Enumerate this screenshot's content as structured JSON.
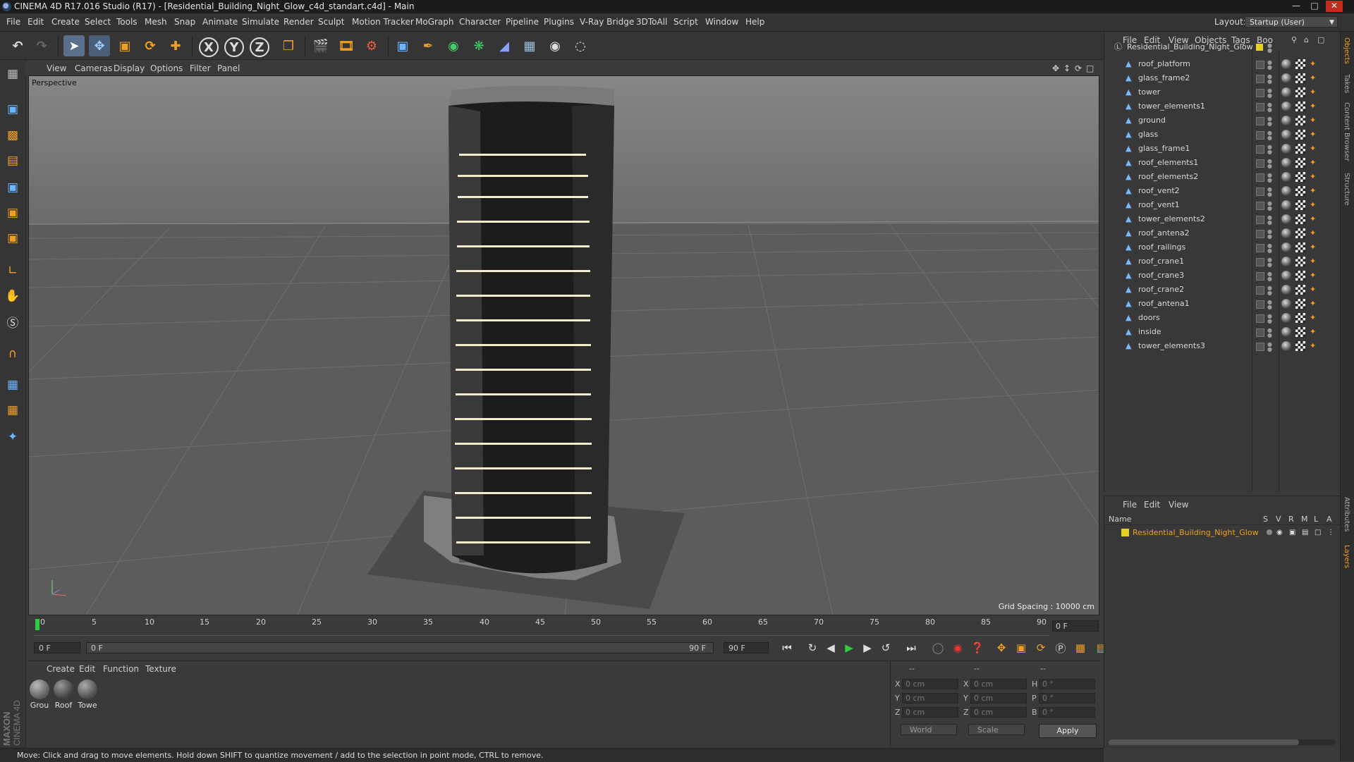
{
  "window": {
    "title": "CINEMA 4D R17.016 Studio (R17) - [Residential_Building_Night_Glow_c4d_standart.c4d] - Main"
  },
  "menu": [
    "File",
    "Edit",
    "Create",
    "Select",
    "Tools",
    "Mesh",
    "Snap",
    "Animate",
    "Simulate",
    "Render",
    "Sculpt",
    "Motion Tracker",
    "MoGraph",
    "Character",
    "Pipeline",
    "Plugins",
    "V-Ray Bridge",
    "3DToAll",
    "Script",
    "Window",
    "Help"
  ],
  "layout": {
    "label": "Layout:",
    "value": "Startup (User)"
  },
  "toolbar": {
    "x_axis": "X",
    "y_axis": "Y",
    "z_axis": "Z"
  },
  "viewport": {
    "menu": [
      "View",
      "Cameras",
      "Display",
      "Options",
      "Filter",
      "Panel"
    ],
    "label": "Perspective",
    "grid_spacing": "Grid Spacing : 10000 cm"
  },
  "timeline": {
    "ticks": [
      "0",
      "5",
      "10",
      "15",
      "20",
      "25",
      "30",
      "35",
      "40",
      "45",
      "50",
      "55",
      "60",
      "65",
      "70",
      "75",
      "80",
      "85",
      "90"
    ],
    "current_frame_right": "0 F",
    "start_field": "0 F",
    "range_start": "0 F",
    "range_end": "90 F",
    "end_field": "90 F"
  },
  "material_manager": {
    "menu": [
      "Create",
      "Edit",
      "Function",
      "Texture"
    ],
    "materials": [
      {
        "label": "Grou",
        "color": "#7a7a7a"
      },
      {
        "label": "Roof",
        "color": "#5b5b5b"
      },
      {
        "label": "Towe",
        "color": "#6d6d6d"
      }
    ]
  },
  "coordinates": {
    "header": [
      "--",
      "--",
      "--"
    ],
    "rows": [
      {
        "l1": "X",
        "v1": "0 cm",
        "l2": "X",
        "v2": "0 cm",
        "l3": "H",
        "v3": "0 °"
      },
      {
        "l1": "Y",
        "v1": "0 cm",
        "l2": "Y",
        "v2": "0 cm",
        "l3": "P",
        "v3": "0 °"
      },
      {
        "l1": "Z",
        "v1": "0 cm",
        "l2": "Z",
        "v2": "0 cm",
        "l3": "B",
        "v3": "0 °"
      }
    ],
    "mode_world": "World",
    "mode_scale": "Scale",
    "apply": "Apply"
  },
  "status": "Move: Click and drag to move elements. Hold down SHIFT to quantize movement / add to the selection in point mode, CTRL to remove.",
  "branding": {
    "maxon": "MAXON",
    "product": "CINEMA 4D"
  },
  "object_manager": {
    "menu": [
      "File",
      "Edit",
      "View",
      "Objects",
      "Tags",
      "Boo"
    ],
    "root": "Residential_Building_Night_Glow",
    "objects": [
      "roof_platform",
      "glass_frame2",
      "tower",
      "tower_elements1",
      "ground",
      "glass",
      "glass_frame1",
      "roof_elements1",
      "roof_elements2",
      "roof_vent2",
      "roof_vent1",
      "tower_elements2",
      "roof_antena2",
      "roof_railings",
      "roof_crane1",
      "roof_crane3",
      "roof_crane2",
      "roof_antena1",
      "doors",
      "inside",
      "tower_elements3"
    ]
  },
  "layer_manager": {
    "menu": [
      "File",
      "Edit",
      "View"
    ],
    "columns": {
      "name": "Name",
      "s": "S",
      "v": "V",
      "r": "R",
      "m": "M",
      "l": "L",
      "a": "A"
    },
    "layer": "Residential_Building_Night_Glow"
  },
  "right_tabs": [
    "Objects",
    "Takes",
    "Content Browser",
    "Structure",
    "Attributes",
    "Layers"
  ],
  "colors": {
    "accent_orange": "#f0a020",
    "layer_yellow": "#e8d020",
    "object_blue": "#7ab6ff"
  }
}
